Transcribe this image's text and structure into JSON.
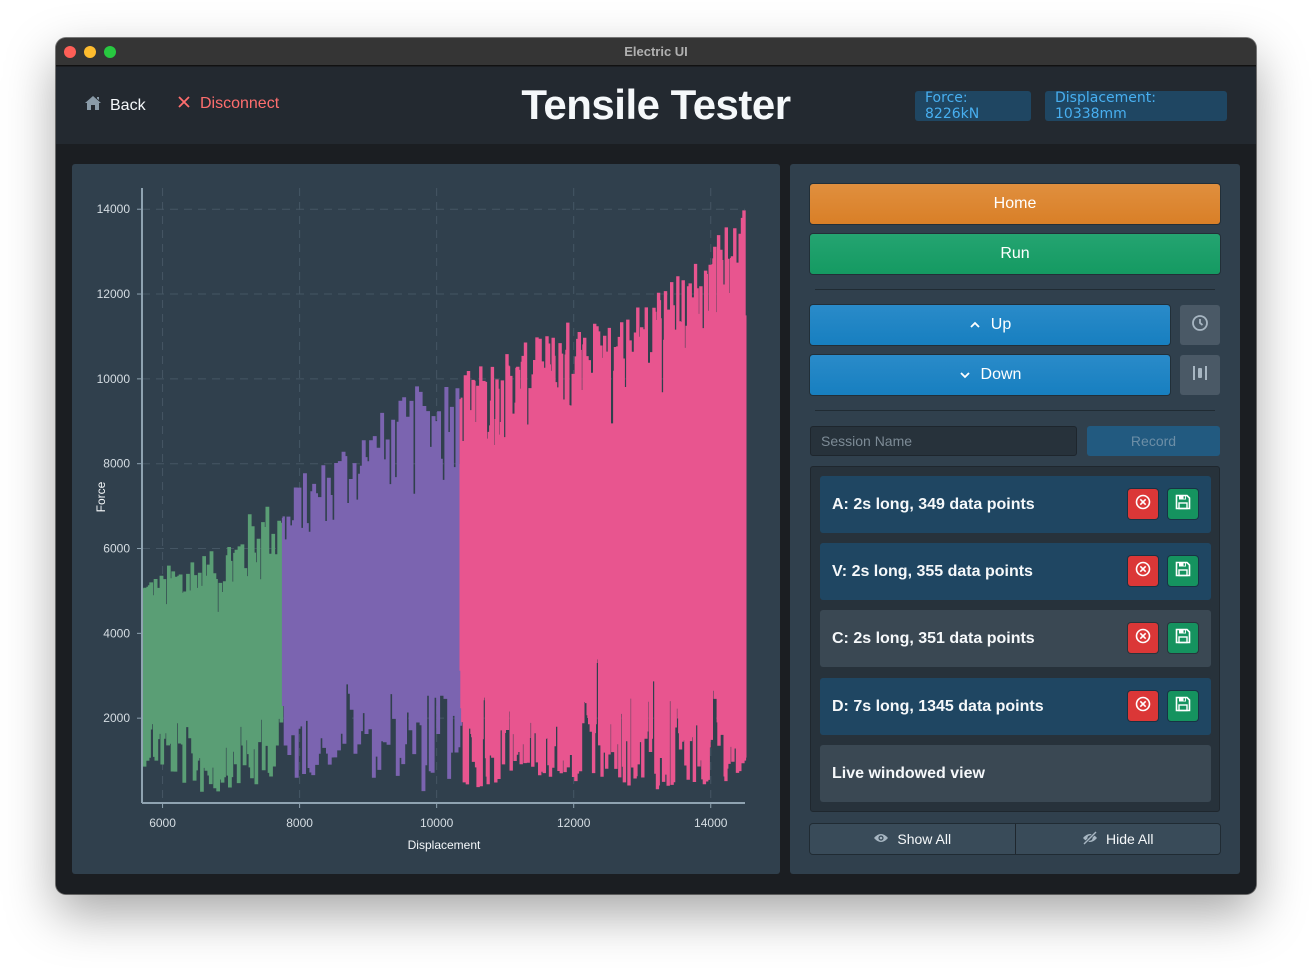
{
  "window": {
    "title": "Electric UI"
  },
  "header": {
    "back_label": "Back",
    "disconnect_label": "Disconnect",
    "title": "Tensile Tester",
    "force_tag": "Force: 8226kN",
    "displacement_tag": "Displacement: 10338mm"
  },
  "controls": {
    "home_label": "Home",
    "run_label": "Run",
    "up_label": "Up",
    "down_label": "Down",
    "session_placeholder": "Session Name",
    "session_value": "",
    "record_label": "Record",
    "recordings": [
      {
        "label": "A: 2s long, 349 data points",
        "highlight": "blue"
      },
      {
        "label": "V: 2s long, 355 data points",
        "highlight": "blue"
      },
      {
        "label": "C: 2s long, 351 data points",
        "highlight": "gray"
      },
      {
        "label": "D: 7s long, 1345 data points",
        "highlight": "blue"
      }
    ],
    "live_view_label": "Live windowed view",
    "show_all_label": "Show All",
    "hide_all_label": "Hide All"
  },
  "colors": {
    "home": "#d98a31",
    "run": "#1a9e67",
    "up_down": "#2083c4",
    "series_green": "#5a9e75",
    "series_purple": "#7b64b0",
    "series_pink": "#e8558f",
    "tag_text": "#48aff0",
    "disconnect": "#ff6e6e"
  },
  "chart_data": {
    "type": "line",
    "title": "",
    "xlabel": "Displacement",
    "ylabel": "Force",
    "xlim": [
      5700,
      14500
    ],
    "ylim": [
      0,
      14500
    ],
    "x_ticks": [
      6000,
      8000,
      10000,
      12000,
      14000
    ],
    "y_ticks": [
      2000,
      4000,
      6000,
      8000,
      10000,
      12000,
      14000
    ],
    "x_tick_labels": [
      "6000",
      "8000",
      "10000",
      "12000",
      "14000"
    ],
    "y_tick_labels": [
      "2000",
      "4000",
      "6000",
      "8000",
      "10000",
      "12000",
      "14000"
    ],
    "grid": true,
    "legend": "none",
    "series": [
      {
        "name": "A",
        "color": "#5a9e75",
        "x_range": [
          5700,
          7750
        ],
        "envelope_high": [
          5500,
          5400,
          5800,
          6000,
          5900,
          6400,
          6800,
          7100,
          7100
        ],
        "envelope_low": [
          900,
          800,
          500,
          300,
          100,
          400,
          300,
          200,
          1500
        ],
        "points": 349
      },
      {
        "name": "V",
        "color": "#7b64b0",
        "x_range": [
          7750,
          10350
        ],
        "envelope_high": [
          7200,
          7800,
          8200,
          8800,
          9100,
          9400,
          9800,
          10200,
          10300
        ],
        "envelope_low": [
          300,
          600,
          800,
          1100,
          600,
          700,
          200,
          400,
          300
        ],
        "points": 355
      },
      {
        "name": "D",
        "color": "#e8558f",
        "x_range": [
          10350,
          14500
        ],
        "envelope_high": [
          10200,
          10500,
          10900,
          11400,
          11500,
          11800,
          12400,
          13200,
          14400
        ],
        "envelope_low": [
          200,
          400,
          700,
          500,
          300,
          400,
          300,
          200,
          700
        ],
        "points": 1345
      }
    ]
  }
}
